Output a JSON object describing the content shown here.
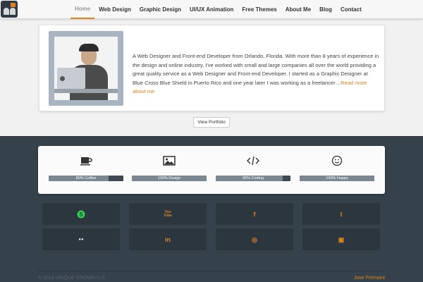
{
  "nav": {
    "items": [
      {
        "label": "Home",
        "active": true
      },
      {
        "label": "Web Design"
      },
      {
        "label": "Graphic Design"
      },
      {
        "label": "UI/UX Animation"
      },
      {
        "label": "Free Themes"
      },
      {
        "label": "About Me"
      },
      {
        "label": "Blog"
      },
      {
        "label": "Contact"
      }
    ]
  },
  "bio": {
    "text": "A Web Designer and Front-end Developer from Orlando, Florida. With more than 8 years of experience in the design and online industry, I've worked with small and large companies all over the world providing a great quality service as a Web Designer and Front-end Developer. I started as a Graphic Designer at Blue Cross Blue Shield in Puerto Rico and one year later I was working as a freelancer…",
    "read_more": "Read more about me"
  },
  "portfolio_button": "View Portfolio",
  "skills": [
    {
      "label": "80% Coffee",
      "percent": 80,
      "icon": "coffee-cup-icon"
    },
    {
      "label": "100% Design",
      "percent": 100,
      "icon": "image-icon"
    },
    {
      "label": "90% Coding",
      "percent": 90,
      "icon": "code-icon"
    },
    {
      "label": "100% Happy",
      "percent": 100,
      "icon": "smiley-icon"
    }
  ],
  "social": [
    {
      "icon": "skype-icon",
      "glyph": "S"
    },
    {
      "icon": "youtube-icon",
      "glyph": "You Tube"
    },
    {
      "icon": "facebook-icon",
      "glyph": "f"
    },
    {
      "icon": "twitter-icon",
      "glyph": "t"
    },
    {
      "icon": "flickr-icon",
      "glyph": "●●"
    },
    {
      "icon": "linkedin-icon",
      "glyph": "in"
    },
    {
      "icon": "dribbble-icon",
      "glyph": "◎"
    },
    {
      "icon": "instagram-icon",
      "glyph": "▣"
    }
  ],
  "footer": {
    "copyright": "© 2014 UNIQUE CROWN LLC",
    "author": "Jose Fremaint"
  },
  "colors": {
    "accent": "#e0821e",
    "dark_bg": "#35414b",
    "tile_bg": "#2c363e",
    "skype_green": "#2fd157"
  }
}
